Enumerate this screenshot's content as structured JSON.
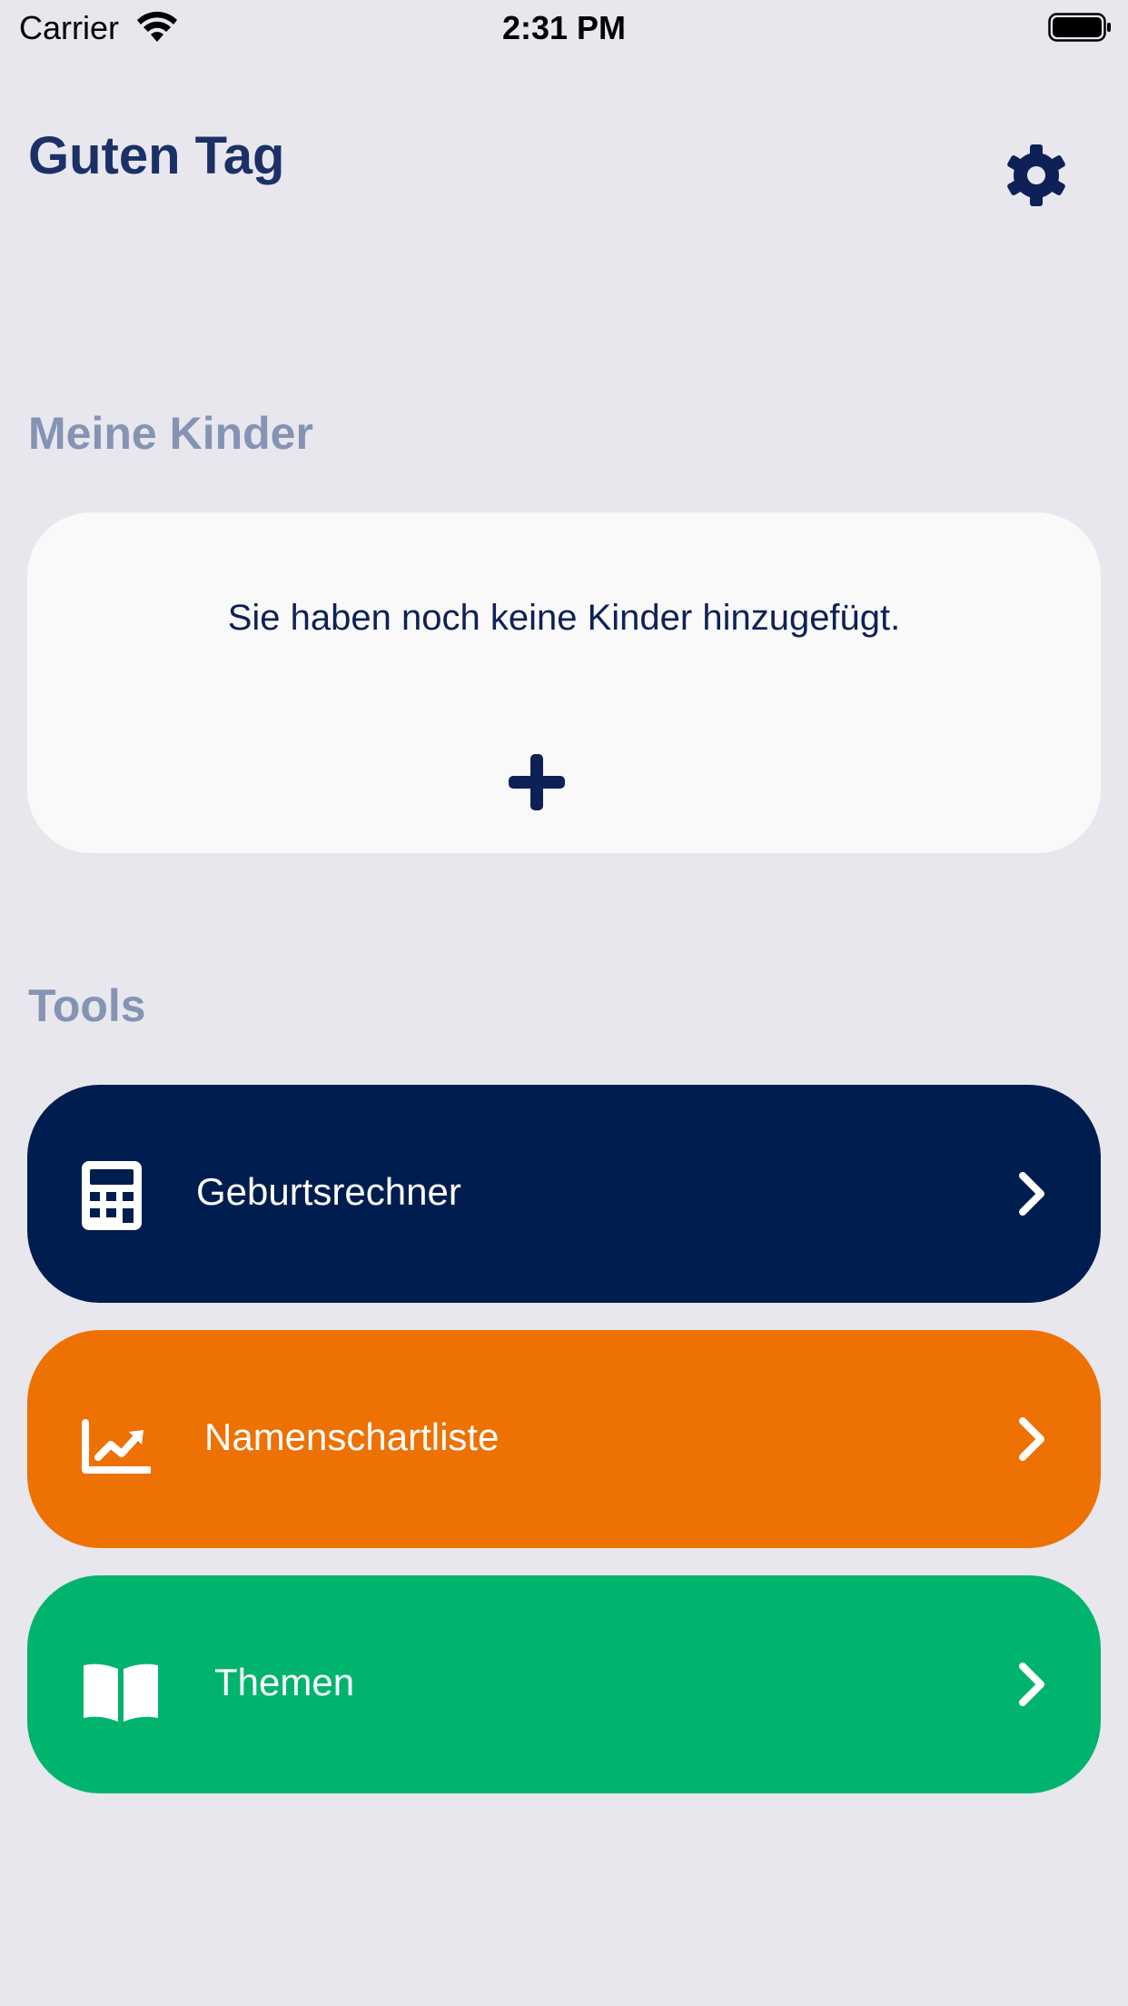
{
  "status_bar": {
    "carrier": "Carrier",
    "time": "2:31 PM",
    "icons": [
      "wifi-icon",
      "battery-icon"
    ]
  },
  "header": {
    "greeting": "Guten Tag",
    "settings_icon": "gear-icon"
  },
  "kids_section": {
    "title": "Meine Kinder",
    "empty_message": "Sie haben noch keine Kinder hinzugefügt.",
    "add_icon": "plus-icon"
  },
  "tools_section": {
    "title": "Tools",
    "items": [
      {
        "label": "Geburtsrechner",
        "icon": "calculator-icon",
        "color": "#001d4f"
      },
      {
        "label": "Namenschartliste",
        "icon": "chart-line-icon",
        "color": "#ee7103"
      },
      {
        "label": "Themen",
        "icon": "book-open-icon",
        "color": "#00b46e"
      }
    ]
  },
  "colors": {
    "background": "#e8e7ed",
    "primary": "#0e2157",
    "section_title": "#8593b4",
    "card": "#f9f9f9"
  }
}
